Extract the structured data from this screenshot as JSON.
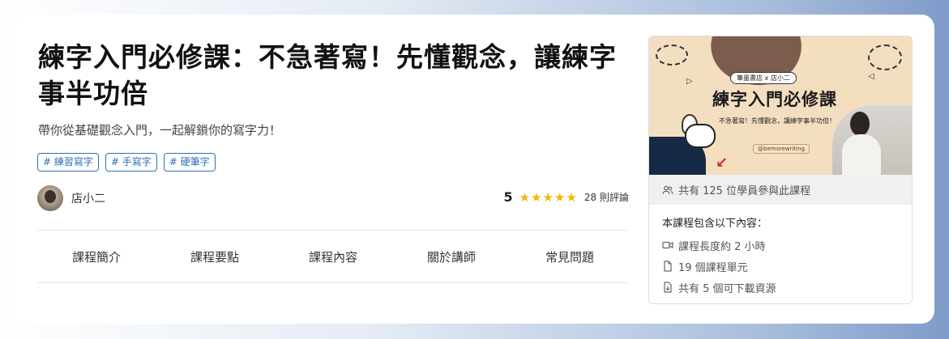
{
  "course": {
    "title": "練字入門必修課：不急著寫！先懂觀念，讓練字事半功倍",
    "subtitle": "帶你從基礎觀念入門，一起解鎖你的寫字力！",
    "tags": [
      "# 練習寫字",
      "# 手寫字",
      "# 硬筆字"
    ],
    "author": "店小二",
    "rating": "5",
    "stars": 5,
    "review_count": "28 則評論"
  },
  "tabs": [
    "課程簡介",
    "課程要點",
    "課程內容",
    "關於講師",
    "常見問題"
  ],
  "thumbnail": {
    "badge": "筆墨書店 x 店小二",
    "title": "練字入門必修課",
    "subtitle": "不急著寫！先懂觀念，讓練字事半功倍！",
    "handle": "@bemorewriting"
  },
  "sidebar": {
    "learners": "共有 125 位學員參與此課程",
    "includes_title": "本課程包含以下內容：",
    "items": [
      {
        "icon": "video-icon",
        "label": "課程長度約 2 小時"
      },
      {
        "icon": "document-icon",
        "label": "19 個課程單元"
      },
      {
        "icon": "download-file-icon",
        "label": "共有 5 個可下載資源"
      }
    ]
  },
  "colors": {
    "tag": "#2d6fb6",
    "star": "#f4b400",
    "thumbnail_bg": "#f4dec0",
    "arrow": "#e32020"
  }
}
